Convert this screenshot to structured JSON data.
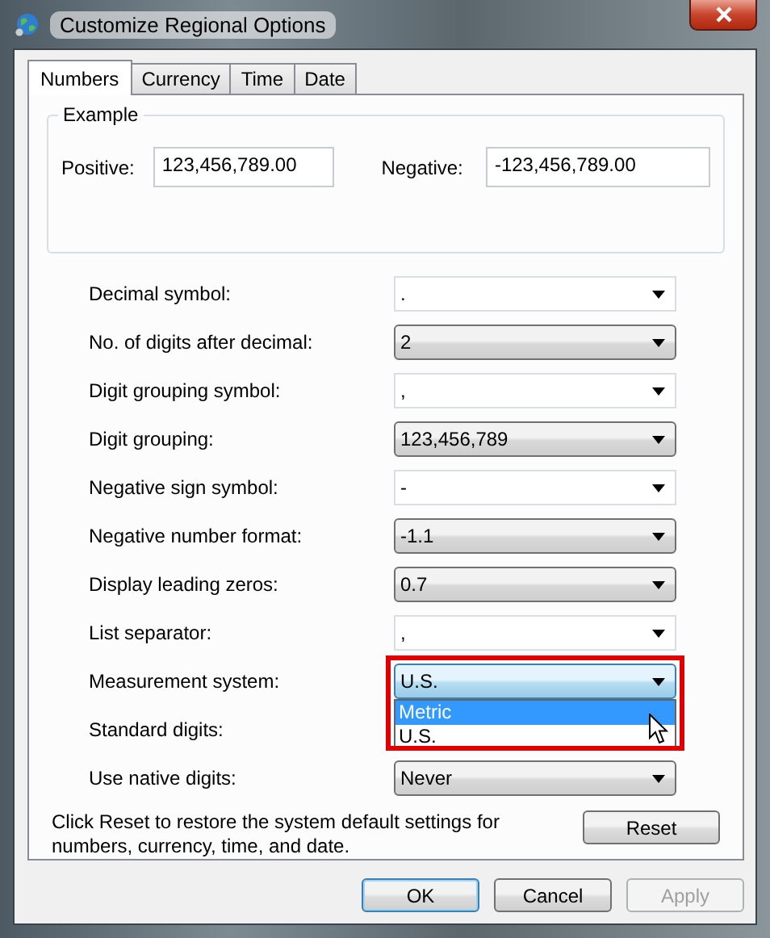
{
  "window": {
    "title": "Customize Regional Options"
  },
  "tabs": [
    {
      "label": "Numbers",
      "selected": true
    },
    {
      "label": "Currency",
      "selected": false
    },
    {
      "label": "Time",
      "selected": false
    },
    {
      "label": "Date",
      "selected": false
    }
  ],
  "example": {
    "title": "Example",
    "positive_label": "Positive:",
    "positive_value": "123,456,789.00",
    "negative_label": "Negative:",
    "negative_value": "-123,456,789.00"
  },
  "settings": [
    {
      "label": "Decimal symbol:",
      "kind": "editable",
      "value": ".",
      "expanded": false
    },
    {
      "label": "No. of digits after decimal:",
      "kind": "list",
      "value": "2",
      "expanded": false
    },
    {
      "label": "Digit grouping symbol:",
      "kind": "editable",
      "value": ",",
      "expanded": false
    },
    {
      "label": "Digit grouping:",
      "kind": "list",
      "value": "123,456,789",
      "expanded": false
    },
    {
      "label": "Negative sign symbol:",
      "kind": "editable",
      "value": "-",
      "expanded": false
    },
    {
      "label": "Negative number format:",
      "kind": "list",
      "value": "-1.1",
      "expanded": false
    },
    {
      "label": "Display leading zeros:",
      "kind": "list",
      "value": "0.7",
      "expanded": false
    },
    {
      "label": "List separator:",
      "kind": "editable",
      "value": ",",
      "expanded": false
    },
    {
      "label": "Measurement system:",
      "kind": "list",
      "value": "U.S.",
      "expanded": true,
      "options": [
        {
          "label": "Metric",
          "highlighted": true
        },
        {
          "label": "U.S.",
          "highlighted": false
        }
      ]
    },
    {
      "label": "Standard digits:",
      "kind": "hidden",
      "expanded": false
    },
    {
      "label": "Use native digits:",
      "kind": "list",
      "value": "Never",
      "expanded": false
    }
  ],
  "note": "Click Reset to restore the system default settings for numbers, currency, time, and date.",
  "reset_button": "Reset",
  "buttons": [
    {
      "label": "OK",
      "kind": "default",
      "disabled": false
    },
    {
      "label": "Cancel",
      "kind": "normal",
      "disabled": false
    },
    {
      "label": "Apply",
      "kind": "normal",
      "disabled": true
    }
  ]
}
